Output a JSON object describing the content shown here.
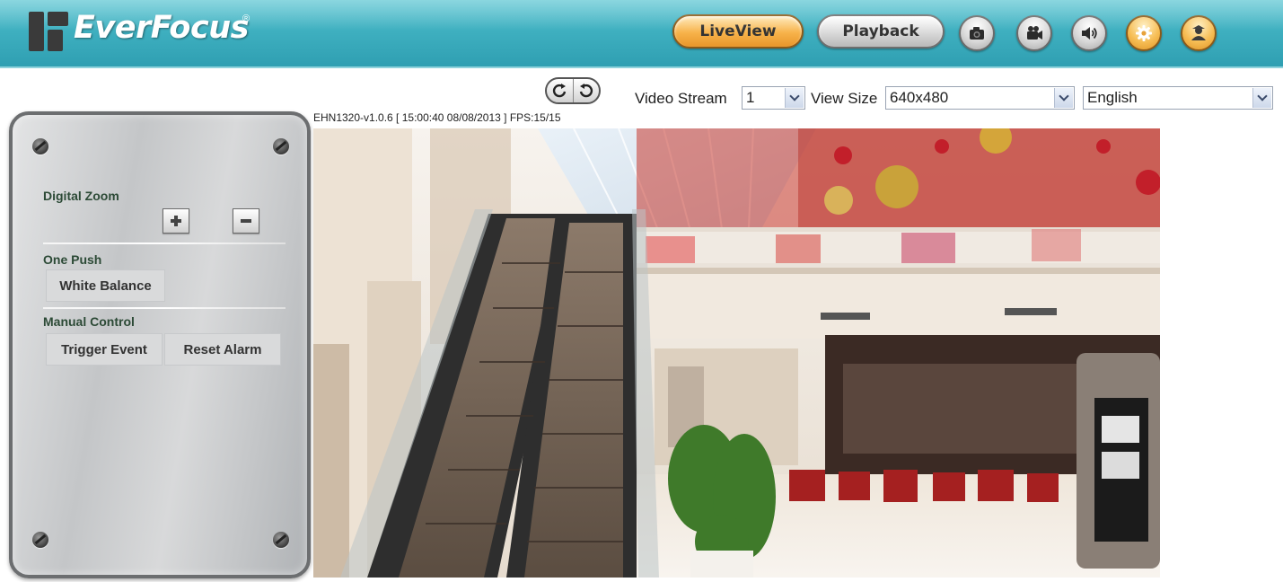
{
  "header": {
    "logo_text": "EverFocus",
    "logo_registered": "®",
    "nav": {
      "liveview_label": "LiveView",
      "playback_label": "Playback"
    },
    "icons": [
      "camera-icon",
      "video-camera-icon",
      "speaker-icon",
      "gear-icon",
      "user-icon"
    ],
    "colors": {
      "header_bg": "#3fb0c0",
      "active_tab": "#f7b24a"
    }
  },
  "toolbar": {
    "video_stream_label": "Video Stream",
    "video_stream_value": "1",
    "view_size_label": "View Size",
    "view_size_value": "640x480",
    "language_value": "English"
  },
  "panel": {
    "digital_zoom_label": "Digital Zoom",
    "one_push_label": "One Push",
    "white_balance_label": "White Balance",
    "manual_control_label": "Manual Control",
    "trigger_event_label": "Trigger Event",
    "reset_alarm_label": "Reset Alarm"
  },
  "video": {
    "status_text": "EHN1320-v1.0.6 [ 15:00:40 08/08/2013 ] FPS:15/15"
  }
}
